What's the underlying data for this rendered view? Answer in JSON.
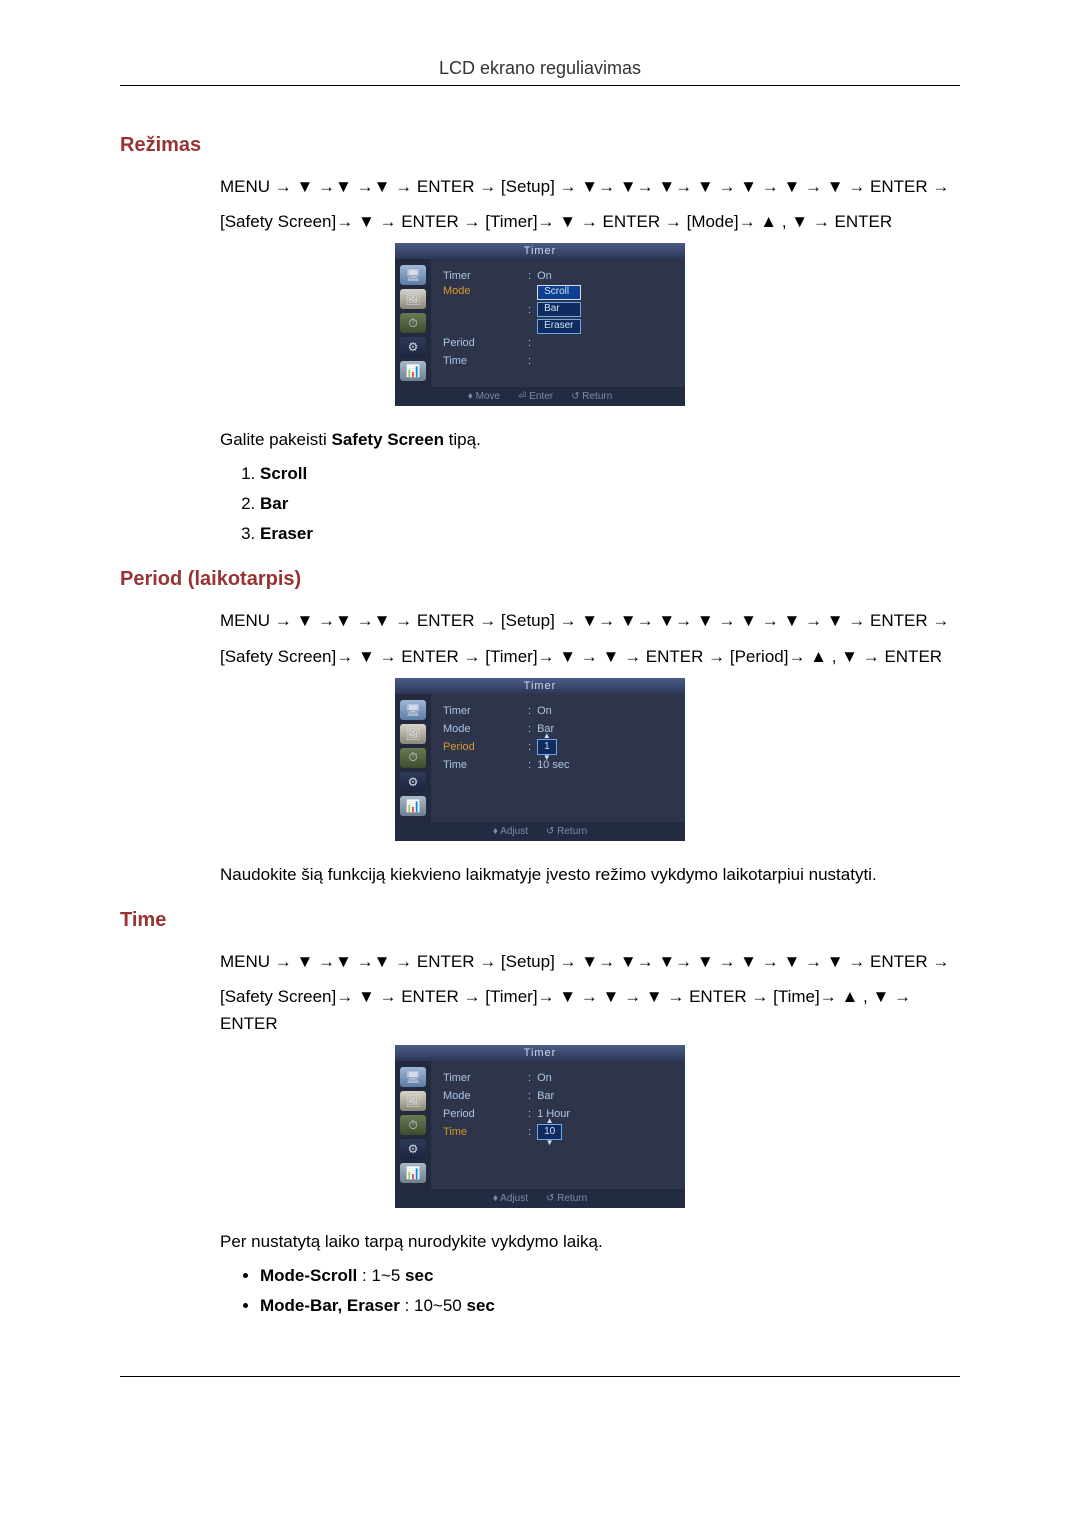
{
  "header": {
    "title": "LCD ekrano reguliavimas"
  },
  "sections": {
    "mode": {
      "heading": "Režimas",
      "nav_line1": "MENU → ▼ →▼ →▼ → ENTER → [Setup] → ▼→ ▼→ ▼→ ▼ → ▼ → ▼ → ▼ → ENTER →",
      "nav_line2": "[Safety Screen]→ ▼ → ENTER → [Timer]→ ▼ → ENTER → [Mode]→ ▲ , ▼ → ENTER",
      "desc_prefix": "Galite pakeisti ",
      "desc_bold": "Safety Screen",
      "desc_suffix": " tipą.",
      "list": [
        "Scroll",
        "Bar",
        "Eraser"
      ],
      "osd": {
        "title": "Timer",
        "rows": {
          "timer_label": "Timer",
          "timer_val": "On",
          "mode_label": "Mode",
          "period_label": "Period",
          "time_label": "Time",
          "options": [
            "Scroll",
            "Bar",
            "Eraser"
          ]
        },
        "foot": {
          "move": "♦ Move",
          "enter": "⏎ Enter",
          "return": "↺ Return"
        }
      }
    },
    "period": {
      "heading": "Period (laikotarpis)",
      "nav_line1": "MENU → ▼ →▼ →▼ → ENTER → [Setup] → ▼→ ▼→ ▼→ ▼ → ▼ → ▼ → ▼ → ENTER →",
      "nav_line2": "[Safety Screen]→ ▼ → ENTER → [Timer]→ ▼ → ▼ → ENTER → [Period]→ ▲ , ▼ → ENTER",
      "desc": "Naudokite šią funkciją kiekvieno laikmatyje įvesto režimo vykdymo laikotarpiui nustatyti.",
      "osd": {
        "title": "Timer",
        "rows": {
          "timer_label": "Timer",
          "timer_val": "On",
          "mode_label": "Mode",
          "mode_val": "Bar",
          "period_label": "Period",
          "period_val": "1",
          "time_label": "Time",
          "time_val": "10 sec"
        },
        "foot": {
          "adjust": "♦ Adjust",
          "return": "↺ Return"
        }
      }
    },
    "time": {
      "heading": "Time",
      "nav_line1": "MENU → ▼ →▼ →▼ → ENTER → [Setup] → ▼→ ▼→ ▼→ ▼ → ▼ → ▼ → ▼ → ENTER →",
      "nav_line2": "[Safety Screen]→ ▼ → ENTER → [Timer]→ ▼ → ▼ → ▼ → ENTER → [Time]→ ▲ , ▼ → ENTER",
      "desc": "Per nustatytą laiko tarpą nurodykite vykdymo laiką.",
      "bullets": {
        "b1_prefix": "Mode-Scroll",
        "b1_suffix": " : 1~5 ",
        "b1_unit": "sec",
        "b2_prefix": "Mode-Bar, Eraser",
        "b2_suffix": " : 10~50 ",
        "b2_unit": "sec"
      },
      "osd": {
        "title": "Timer",
        "rows": {
          "timer_label": "Timer",
          "timer_val": "On",
          "mode_label": "Mode",
          "mode_val": "Bar",
          "period_label": "Period",
          "period_val": "1 Hour",
          "time_label": "Time",
          "time_val": "10"
        },
        "foot": {
          "adjust": "♦ Adjust",
          "return": "↺ Return"
        }
      }
    }
  }
}
